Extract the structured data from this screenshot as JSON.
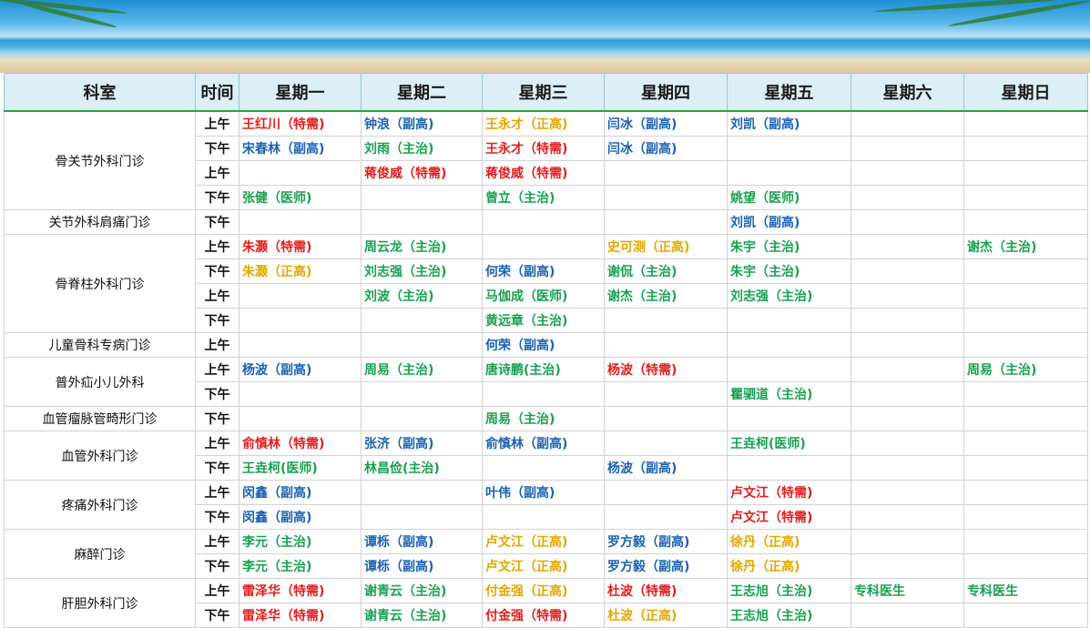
{
  "colors": {
    "red": "#e01e1e",
    "blue": "#1a62b0",
    "green": "#1aa050",
    "gold": "#e0a800",
    "header_bg": "#dceef6"
  },
  "headers": [
    "科室",
    "时间",
    "星期一",
    "星期二",
    "星期三",
    "星期四",
    "星期五",
    "星期六",
    "星期日"
  ],
  "departments": [
    {
      "name": "骨关节外科门诊",
      "rows": [
        {
          "time": "上午",
          "cells": [
            {
              "t": "王红川（特需)",
              "c": "red"
            },
            {
              "t": "钟浪（副高)",
              "c": "blue"
            },
            {
              "t": "王永才（正高)",
              "c": "gold"
            },
            {
              "t": "闫冰（副高)",
              "c": "blue"
            },
            {
              "t": "刘凯（副高)",
              "c": "blue"
            },
            {
              "t": ""
            },
            {
              "t": ""
            }
          ]
        },
        {
          "time": "下午",
          "cells": [
            {
              "t": "宋春林（副高)",
              "c": "blue"
            },
            {
              "t": "刘雨（主治)",
              "c": "green"
            },
            {
              "t": "王永才（特需)",
              "c": "red"
            },
            {
              "t": "闫冰（副高)",
              "c": "blue"
            },
            {
              "t": ""
            },
            {
              "t": ""
            },
            {
              "t": ""
            }
          ]
        },
        {
          "time": "上午",
          "cells": [
            {
              "t": ""
            },
            {
              "t": "蒋俊威（特需)",
              "c": "red"
            },
            {
              "t": "蒋俊威（特需)",
              "c": "red"
            },
            {
              "t": ""
            },
            {
              "t": ""
            },
            {
              "t": ""
            },
            {
              "t": ""
            }
          ]
        },
        {
          "time": "下午",
          "cells": [
            {
              "t": "张健（医师)",
              "c": "green"
            },
            {
              "t": ""
            },
            {
              "t": "曾立（主治)",
              "c": "green"
            },
            {
              "t": ""
            },
            {
              "t": "姚望（医师)",
              "c": "green"
            },
            {
              "t": ""
            },
            {
              "t": ""
            }
          ]
        }
      ]
    },
    {
      "name": "关节外科肩痛门诊",
      "rows": [
        {
          "time": "下午",
          "cells": [
            {
              "t": ""
            },
            {
              "t": ""
            },
            {
              "t": ""
            },
            {
              "t": ""
            },
            {
              "t": "刘凯（副高)",
              "c": "blue"
            },
            {
              "t": ""
            },
            {
              "t": ""
            }
          ]
        }
      ]
    },
    {
      "name": "骨脊柱外科门诊",
      "rows": [
        {
          "time": "上午",
          "cells": [
            {
              "t": "朱灏（特需)",
              "c": "red"
            },
            {
              "t": "周云龙（主治)",
              "c": "green"
            },
            {
              "t": ""
            },
            {
              "t": "史可测（正高)",
              "c": "gold"
            },
            {
              "t": "朱宇（主治)",
              "c": "green"
            },
            {
              "t": ""
            },
            {
              "t": "谢杰（主治)",
              "c": "green"
            }
          ]
        },
        {
          "time": "下午",
          "cells": [
            {
              "t": "朱灏（正高)",
              "c": "gold"
            },
            {
              "t": "刘志强（主治)",
              "c": "green"
            },
            {
              "t": "何荣（副高)",
              "c": "blue"
            },
            {
              "t": "谢侃（主治)",
              "c": "green"
            },
            {
              "t": "朱宇（主治)",
              "c": "green"
            },
            {
              "t": ""
            },
            {
              "t": ""
            }
          ]
        },
        {
          "time": "上午",
          "cells": [
            {
              "t": ""
            },
            {
              "t": "刘波（主治)",
              "c": "green"
            },
            {
              "t": "马伽成（医师)",
              "c": "green"
            },
            {
              "t": "谢杰（主治)",
              "c": "green"
            },
            {
              "t": "刘志强（主治)",
              "c": "green"
            },
            {
              "t": ""
            },
            {
              "t": ""
            }
          ]
        },
        {
          "time": "下午",
          "cells": [
            {
              "t": ""
            },
            {
              "t": ""
            },
            {
              "t": "黄远章（主治)",
              "c": "green"
            },
            {
              "t": ""
            },
            {
              "t": ""
            },
            {
              "t": ""
            },
            {
              "t": ""
            }
          ]
        }
      ]
    },
    {
      "name": "儿童骨科专病门诊",
      "rows": [
        {
          "time": "上午",
          "cells": [
            {
              "t": ""
            },
            {
              "t": ""
            },
            {
              "t": "何荣（副高)",
              "c": "blue"
            },
            {
              "t": ""
            },
            {
              "t": ""
            },
            {
              "t": ""
            },
            {
              "t": ""
            }
          ]
        }
      ]
    },
    {
      "name": "普外疝小儿外科",
      "rows": [
        {
          "time": "上午",
          "cells": [
            {
              "t": "杨波（副高)",
              "c": "blue"
            },
            {
              "t": "周易（主治)",
              "c": "green"
            },
            {
              "t": "唐诗鹏(主治)",
              "c": "green"
            },
            {
              "t": "杨波（特需)",
              "c": "red"
            },
            {
              "t": ""
            },
            {
              "t": ""
            },
            {
              "t": "周易（主治)",
              "c": "green"
            }
          ]
        },
        {
          "time": "下午",
          "cells": [
            {
              "t": ""
            },
            {
              "t": ""
            },
            {
              "t": ""
            },
            {
              "t": ""
            },
            {
              "t": "瞿驷道（主治)",
              "c": "green"
            },
            {
              "t": ""
            },
            {
              "t": ""
            }
          ]
        }
      ]
    },
    {
      "name": "血管瘤脉管畸形门诊",
      "rows": [
        {
          "time": "下午",
          "cells": [
            {
              "t": ""
            },
            {
              "t": ""
            },
            {
              "t": "周易（主治)",
              "c": "green"
            },
            {
              "t": ""
            },
            {
              "t": ""
            },
            {
              "t": ""
            },
            {
              "t": ""
            }
          ]
        }
      ]
    },
    {
      "name": "血管外科门诊",
      "rows": [
        {
          "time": "上午",
          "cells": [
            {
              "t": "俞慎林（特需)",
              "c": "red"
            },
            {
              "t": "张济（副高)",
              "c": "blue"
            },
            {
              "t": "俞慎林（副高)",
              "c": "blue"
            },
            {
              "t": ""
            },
            {
              "t": "王垚柯(医师)",
              "c": "green"
            },
            {
              "t": ""
            },
            {
              "t": ""
            }
          ]
        },
        {
          "time": "下午",
          "cells": [
            {
              "t": "王垚柯(医师)",
              "c": "green"
            },
            {
              "t": "林昌俭(主治)",
              "c": "green"
            },
            {
              "t": ""
            },
            {
              "t": "杨波（副高)",
              "c": "blue"
            },
            {
              "t": ""
            },
            {
              "t": ""
            },
            {
              "t": ""
            }
          ]
        }
      ]
    },
    {
      "name": "疼痛外科门诊",
      "rows": [
        {
          "time": "上午",
          "cells": [
            {
              "t": "闵鑫（副高)",
              "c": "blue"
            },
            {
              "t": ""
            },
            {
              "t": "叶伟（副高)",
              "c": "blue"
            },
            {
              "t": ""
            },
            {
              "t": "卢文江（特需)",
              "c": "red"
            },
            {
              "t": ""
            },
            {
              "t": ""
            }
          ]
        },
        {
          "time": "下午",
          "cells": [
            {
              "t": "闵鑫（副高)",
              "c": "blue"
            },
            {
              "t": ""
            },
            {
              "t": ""
            },
            {
              "t": ""
            },
            {
              "t": "卢文江（特需)",
              "c": "red"
            },
            {
              "t": ""
            },
            {
              "t": ""
            }
          ]
        }
      ]
    },
    {
      "name": "麻醉门诊",
      "rows": [
        {
          "time": "上午",
          "cells": [
            {
              "t": "李元（主治)",
              "c": "green"
            },
            {
              "t": "谭栎（副高)",
              "c": "blue"
            },
            {
              "t": "卢文江（正高)",
              "c": "gold"
            },
            {
              "t": "罗方毅（副高)",
              "c": "blue"
            },
            {
              "t": "徐丹（正高)",
              "c": "gold"
            },
            {
              "t": ""
            },
            {
              "t": ""
            }
          ]
        },
        {
          "time": "下午",
          "cells": [
            {
              "t": "李元（主治)",
              "c": "green"
            },
            {
              "t": "谭栎（副高)",
              "c": "blue"
            },
            {
              "t": "卢文江（正高)",
              "c": "gold"
            },
            {
              "t": "罗方毅（副高)",
              "c": "blue"
            },
            {
              "t": "徐丹（正高)",
              "c": "gold"
            },
            {
              "t": ""
            },
            {
              "t": ""
            }
          ]
        }
      ]
    },
    {
      "name": "肝胆外科门诊",
      "rows": [
        {
          "time": "上午",
          "cells": [
            {
              "t": "雷泽华（特需)",
              "c": "red"
            },
            {
              "t": "谢青云（主治)",
              "c": "green"
            },
            {
              "t": "付金强（正高)",
              "c": "gold"
            },
            {
              "t": "杜波（特需)",
              "c": "red"
            },
            {
              "t": "王志旭（主治)",
              "c": "green"
            },
            {
              "t": "专科医生",
              "c": "green"
            },
            {
              "t": "专科医生",
              "c": "green"
            }
          ]
        },
        {
          "time": "下午",
          "cells": [
            {
              "t": "雷泽华（特需)",
              "c": "red"
            },
            {
              "t": "谢青云（主治)",
              "c": "green"
            },
            {
              "t": "付金强（特需)",
              "c": "red"
            },
            {
              "t": "杜波（正高)",
              "c": "gold"
            },
            {
              "t": "王志旭（主治)",
              "c": "green"
            },
            {
              "t": ""
            },
            {
              "t": ""
            }
          ]
        }
      ]
    }
  ]
}
